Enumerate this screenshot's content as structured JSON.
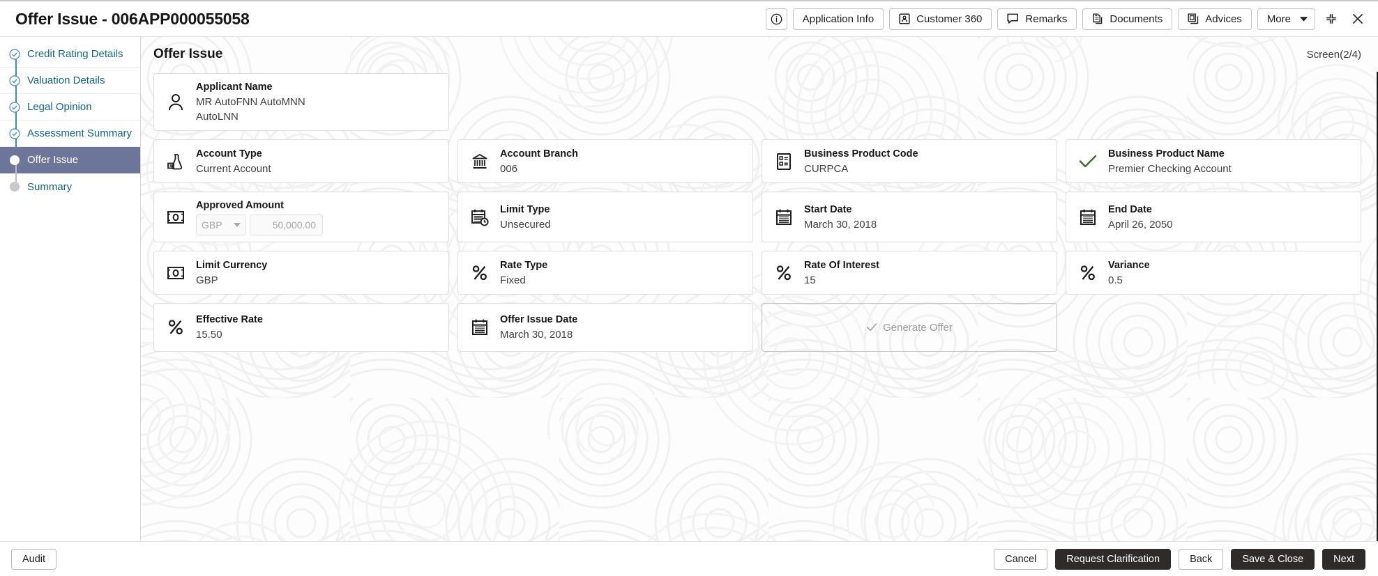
{
  "window": {
    "title": "Offer Issue - 006APP000055058"
  },
  "toolbar": {
    "info_icon": "info-circle-icon",
    "buttons": [
      {
        "label": "Application Info",
        "icon": "none"
      },
      {
        "label": "Customer 360",
        "icon": "user-card-icon"
      },
      {
        "label": "Remarks",
        "icon": "speech-bubble-icon"
      },
      {
        "label": "Documents",
        "icon": "documents-icon"
      },
      {
        "label": "Advices",
        "icon": "advices-icon"
      },
      {
        "label": "More",
        "icon": "chevron-down-icon"
      }
    ],
    "minimize_icon": "collapse-icon",
    "close_icon": "close-icon"
  },
  "sidebar": {
    "items": [
      {
        "label": "Credit Rating Details",
        "state": "completed"
      },
      {
        "label": "Valuation Details",
        "state": "completed"
      },
      {
        "label": "Legal Opinion",
        "state": "completed"
      },
      {
        "label": "Assessment Summary",
        "state": "completed"
      },
      {
        "label": "Offer Issue",
        "state": "active"
      },
      {
        "label": "Summary",
        "state": "pending"
      }
    ]
  },
  "main": {
    "section_title": "Offer Issue",
    "screen_counter": "Screen(2/4)",
    "applicant": {
      "label": "Applicant Name",
      "value_line1": "MR AutoFNN AutoMNN",
      "value_line2": "AutoLNN",
      "icon": "person-icon"
    },
    "fields": [
      {
        "label": "Account Type",
        "value": "Current Account",
        "icon": "flask-account-icon"
      },
      {
        "label": "Account Branch",
        "value": "006",
        "icon": "bank-icon"
      },
      {
        "label": "Business Product Code",
        "value": "CURPCA",
        "icon": "product-list-icon"
      },
      {
        "label": "Business Product Name",
        "value": "Premier Checking Account",
        "icon": "check-icon"
      },
      {
        "label": "Limit Type",
        "value": "Unsecured",
        "icon": "calendar-clock-icon"
      },
      {
        "label": "Start Date",
        "value": "March 30, 2018",
        "icon": "calendar-icon"
      },
      {
        "label": "End Date",
        "value": "April 26, 2050",
        "icon": "calendar-icon"
      },
      {
        "label": "Limit Currency",
        "value": "GBP",
        "icon": "money-icon"
      },
      {
        "label": "Rate Type",
        "value": "Fixed",
        "icon": "percent-icon"
      },
      {
        "label": "Rate Of Interest",
        "value": "15",
        "icon": "percent-icon"
      },
      {
        "label": "Variance",
        "value": "0.5",
        "icon": "percent-icon"
      },
      {
        "label": "Effective Rate",
        "value": "15.50",
        "icon": "percent-icon"
      },
      {
        "label": "Offer Issue Date",
        "value": "March 30, 2018",
        "icon": "calendar-icon"
      }
    ],
    "approved_amount": {
      "label": "Approved Amount",
      "currency": "GBP",
      "amount": "50,000.00",
      "icon": "money-icon",
      "disabled": true
    },
    "generate_offer": {
      "label": "Generate Offer",
      "icon": "check-icon",
      "disabled": true
    }
  },
  "footer": {
    "audit_label": "Audit",
    "buttons": [
      {
        "label": "Cancel",
        "style": "outline"
      },
      {
        "label": "Request Clarification",
        "style": "dark"
      },
      {
        "label": "Back",
        "style": "outline"
      },
      {
        "label": "Save & Close",
        "style": "dark"
      },
      {
        "label": "Next",
        "style": "dark"
      }
    ]
  },
  "colors": {
    "accent_blue": "#10658f",
    "active_nav": "#6d7599",
    "dark_button": "#2e2b28",
    "check_green": "#3d6b2e"
  }
}
